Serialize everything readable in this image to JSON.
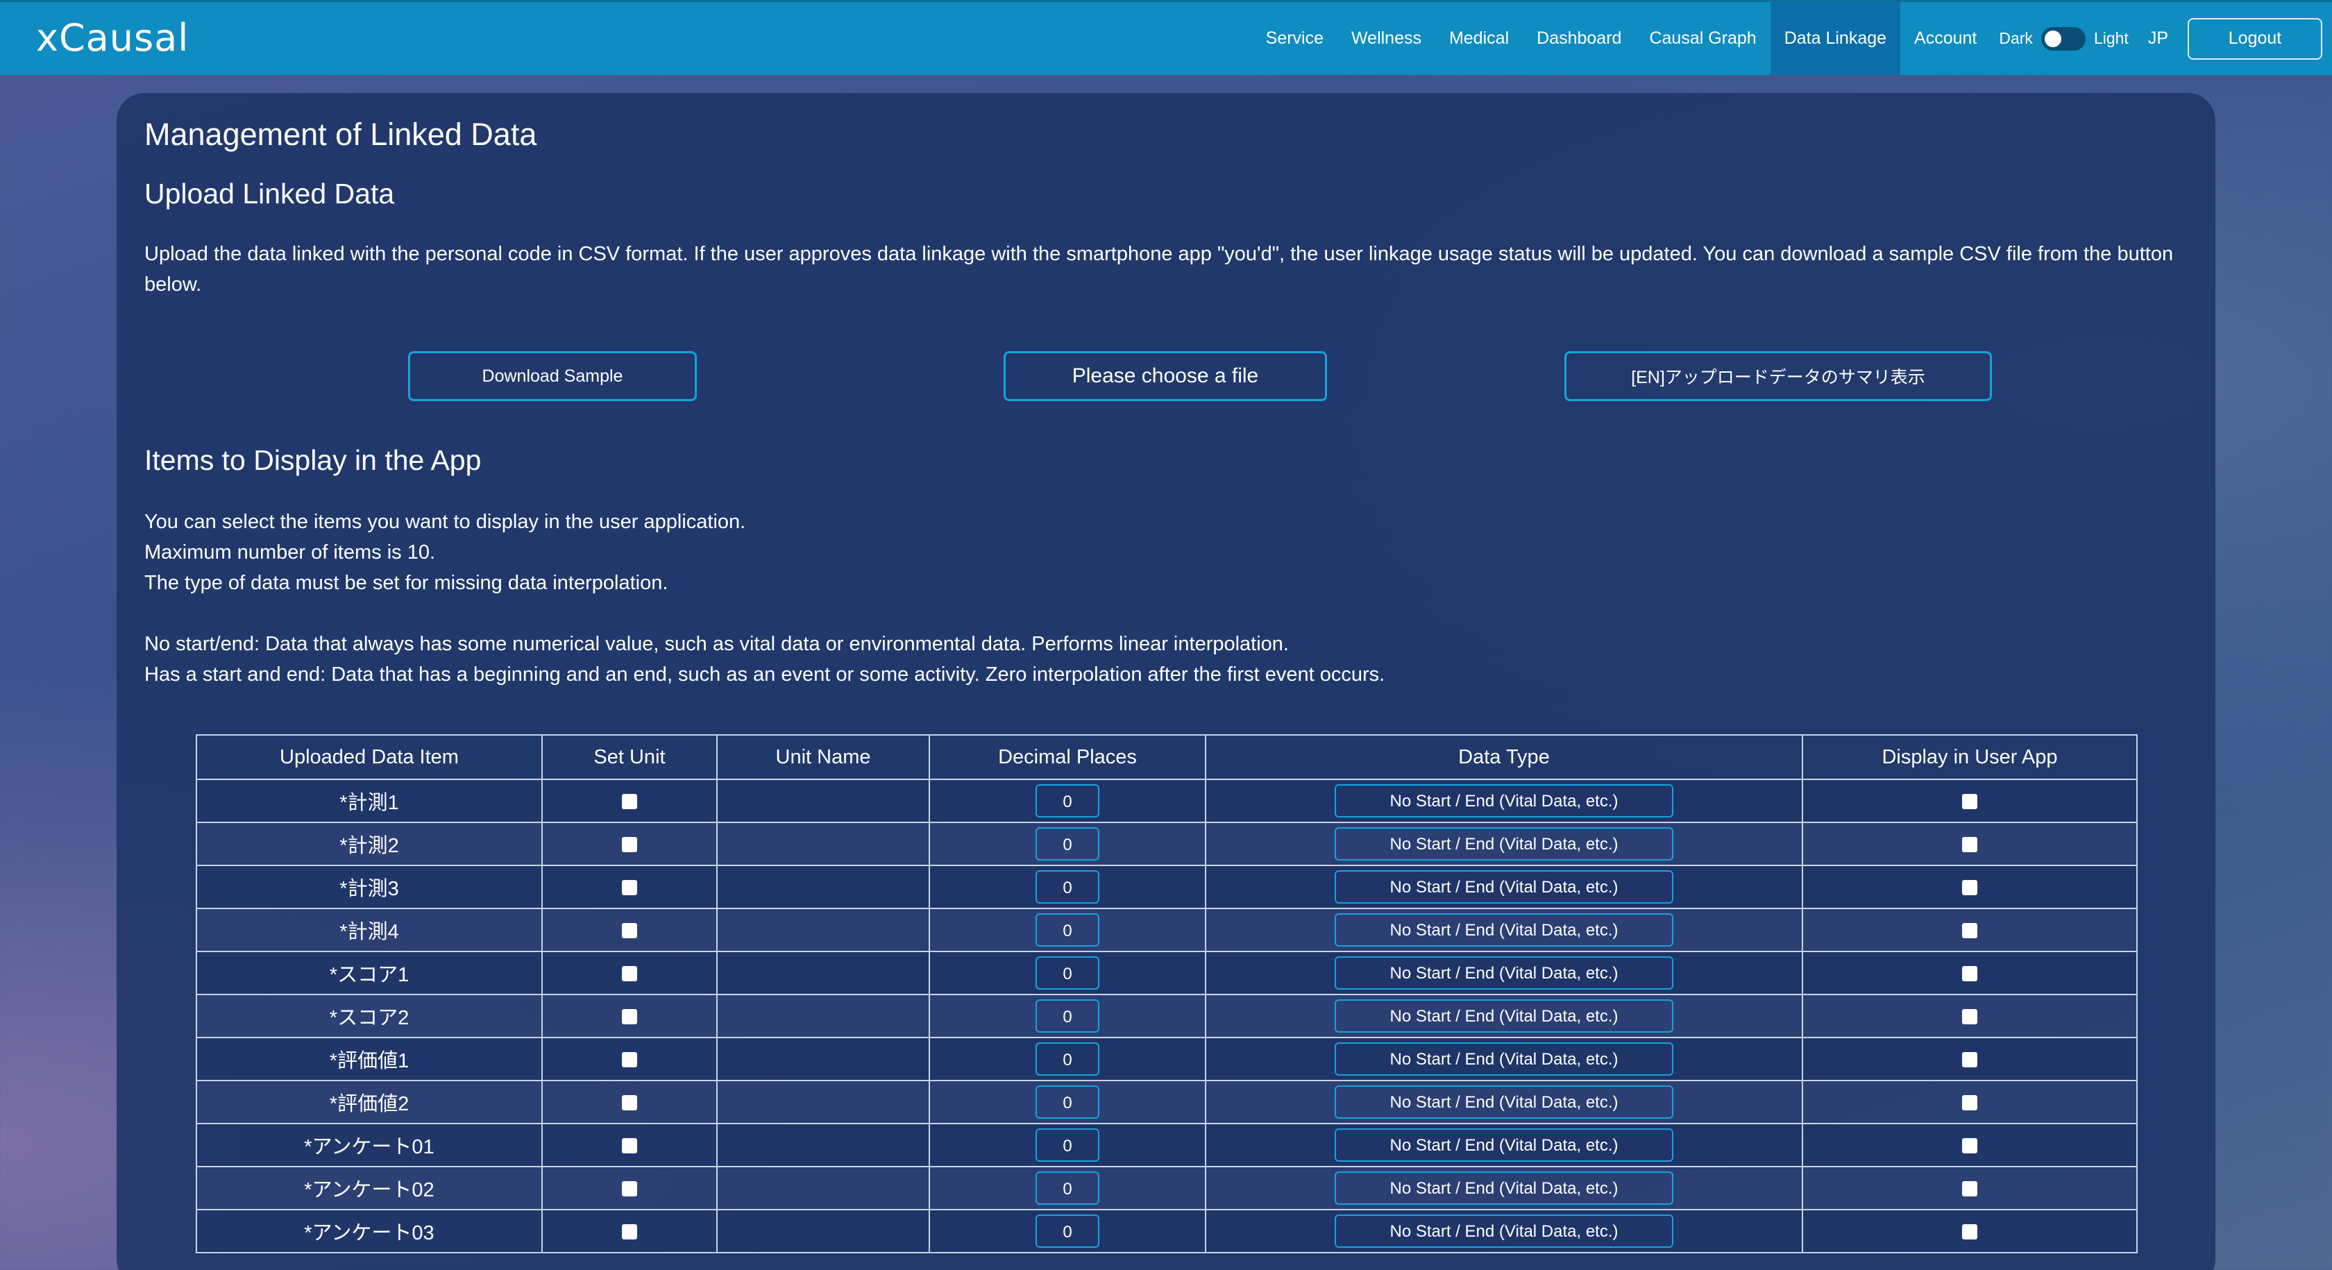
{
  "app": {
    "brand": "xCausal"
  },
  "nav": {
    "items": [
      "Service",
      "Wellness",
      "Medical",
      "Dashboard",
      "Causal Graph",
      "Data Linkage",
      "Account"
    ],
    "active": "Data Linkage",
    "theme_dark": "Dark",
    "theme_light": "Light",
    "theme_state": "dark",
    "lang": "JP",
    "logout": "Logout"
  },
  "page": {
    "title": "Management of Linked Data",
    "upload": {
      "title": "Upload Linked Data",
      "description": "Upload the data linked with the personal code in CSV format. If the user approves data linkage with the smartphone app \"you'd\", the user linkage usage status will be updated. You can download a sample CSV file from the button below.",
      "download_button": "Download Sample",
      "choose_file_button": "Please choose a file",
      "summary_button": "[EN]アップロードデータのサマリ表示"
    },
    "items": {
      "title": "Items to Display in the App",
      "lines": [
        "You can select the items you want to display in the user application.",
        "Maximum number of items is 10.",
        "The type of data must be set for missing data interpolation.",
        "",
        "No start/end: Data that always has some numerical value, such as vital data or environmental data. Performs linear interpolation.",
        "Has a start and end: Data that has a beginning and an end, such as an event or some activity. Zero interpolation after the first event occurs."
      ]
    }
  },
  "table": {
    "headers": [
      "Uploaded Data Item",
      "Set Unit",
      "Unit Name",
      "Decimal Places",
      "Data Type",
      "Display in User App"
    ],
    "rows": [
      {
        "item": "*計測1",
        "set_unit": false,
        "unit_name": "",
        "decimals": "0",
        "data_type": "No Start / End (Vital Data, etc.)",
        "display": false
      },
      {
        "item": "*計測2",
        "set_unit": false,
        "unit_name": "",
        "decimals": "0",
        "data_type": "No Start / End (Vital Data, etc.)",
        "display": false
      },
      {
        "item": "*計測3",
        "set_unit": false,
        "unit_name": "",
        "decimals": "0",
        "data_type": "No Start / End (Vital Data, etc.)",
        "display": false
      },
      {
        "item": "*計測4",
        "set_unit": false,
        "unit_name": "",
        "decimals": "0",
        "data_type": "No Start / End (Vital Data, etc.)",
        "display": false
      },
      {
        "item": "*スコア1",
        "set_unit": false,
        "unit_name": "",
        "decimals": "0",
        "data_type": "No Start / End (Vital Data, etc.)",
        "display": false
      },
      {
        "item": "*スコア2",
        "set_unit": false,
        "unit_name": "",
        "decimals": "0",
        "data_type": "No Start / End (Vital Data, etc.)",
        "display": false
      },
      {
        "item": "*評価値1",
        "set_unit": false,
        "unit_name": "",
        "decimals": "0",
        "data_type": "No Start / End (Vital Data, etc.)",
        "display": false
      },
      {
        "item": "*評価値2",
        "set_unit": false,
        "unit_name": "",
        "decimals": "0",
        "data_type": "No Start / End (Vital Data, etc.)",
        "display": false
      },
      {
        "item": "*アンケート01",
        "set_unit": false,
        "unit_name": "",
        "decimals": "0",
        "data_type": "No Start / End (Vital Data, etc.)",
        "display": false
      },
      {
        "item": "*アンケート02",
        "set_unit": false,
        "unit_name": "",
        "decimals": "0",
        "data_type": "No Start / End (Vital Data, etc.)",
        "display": false
      },
      {
        "item": "*アンケート03",
        "set_unit": false,
        "unit_name": "",
        "decimals": "0",
        "data_type": "No Start / End (Vital Data, etc.)",
        "display": false
      }
    ]
  },
  "colors": {
    "navbar": "#0f8cc0",
    "nav_active": "#0b6ea8",
    "accent_border": "#17a3dc",
    "panel": "#1e3466"
  }
}
